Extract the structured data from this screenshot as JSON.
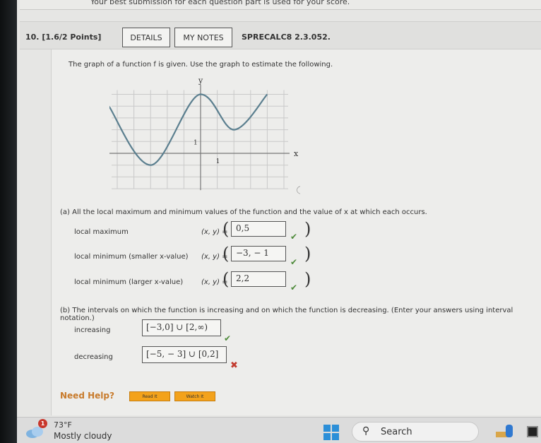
{
  "top_note": "Your best submission for each question part is used for your score.",
  "question": {
    "number": "10.",
    "points": "[1.6/2 Points]",
    "details_label": "DETAILS",
    "my_notes_label": "MY NOTES",
    "reference": "SPRECALC8 2.3.052.",
    "prompt": "The graph of a function f is given. Use the graph to estimate the following."
  },
  "graph": {
    "x_label": "x",
    "y_label": "y",
    "x_tick_label": "1",
    "y_tick_label": "1",
    "x_range": [
      -5,
      5
    ],
    "y_range": [
      -3,
      5
    ],
    "key_points": [
      [
        -5.5,
        4
      ],
      [
        -3,
        -1
      ],
      [
        0,
        5
      ],
      [
        2,
        2
      ],
      [
        4,
        5
      ]
    ],
    "info_icon": "ⓘ",
    "curve_color": "#5b7f8f"
  },
  "part_a": {
    "title": "(a)  All the local maximum and minimum values of the function and the value of x at which each occurs.",
    "rows": [
      {
        "label": "local maximum",
        "xy": "(x, y) =",
        "answer": "0,5",
        "status": "correct"
      },
      {
        "label": "local minimum (smaller x-value)",
        "xy": "(x, y) =",
        "answer": "−3, − 1",
        "status": "correct"
      },
      {
        "label": "local minimum (larger x-value)",
        "xy": "(x, y) =",
        "answer": "2,2",
        "status": "correct"
      }
    ]
  },
  "part_b": {
    "title": "(b)  The intervals on which the function is increasing and on which the function is decreasing. (Enter your answers using interval notation.)",
    "increasing_label": "increasing",
    "increasing_answer": "[−3,0] ∪ [2,∞)",
    "increasing_status": "correct",
    "decreasing_label": "decreasing",
    "decreasing_answer": "[−5, − 3] ∪ [0,2]",
    "decreasing_status": "incorrect"
  },
  "help": {
    "label": "Need Help?",
    "read_it": "Read It",
    "watch_it": "Watch It"
  },
  "status_marks": {
    "correct": "✔",
    "incorrect": "✖"
  },
  "taskbar": {
    "weather_badge": "1",
    "temperature": "73°F",
    "weather_desc": "Mostly cloudy",
    "search_label": "Search",
    "search_icon": "⚲"
  }
}
